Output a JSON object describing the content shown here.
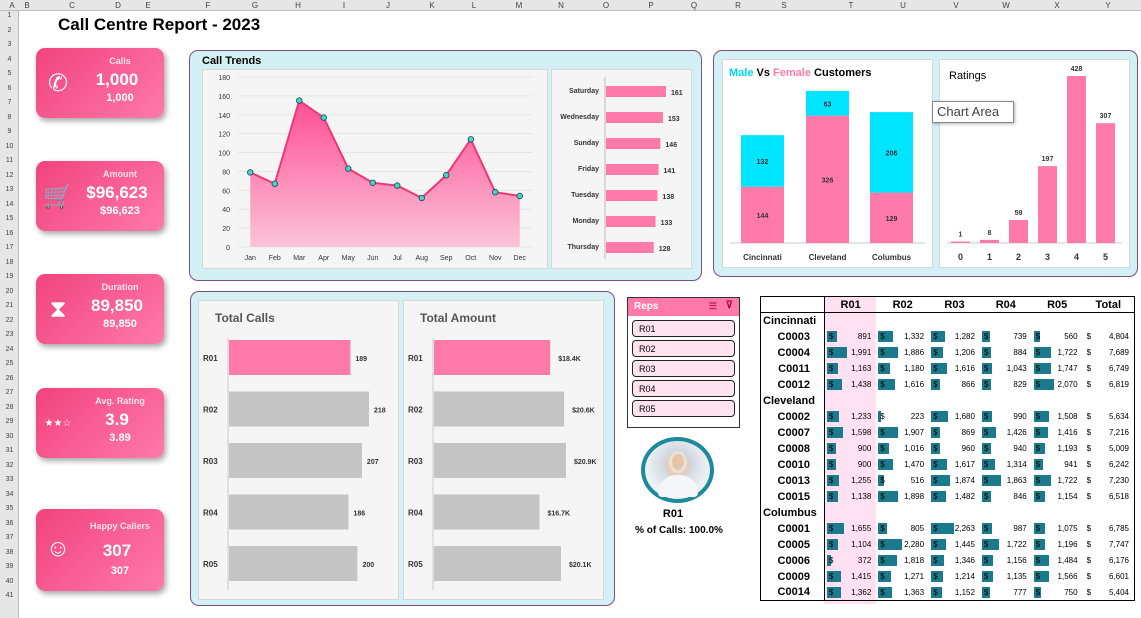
{
  "sheet": {
    "columns": [
      "A",
      "B",
      "C",
      "D",
      "E",
      "F",
      "G",
      "H",
      "I",
      "J",
      "K",
      "L",
      "M",
      "N",
      "O",
      "P",
      "Q",
      "R",
      "S",
      "T",
      "U",
      "V",
      "W",
      "X",
      "Y"
    ],
    "rows": [
      "1",
      "2",
      "3",
      "4",
      "5",
      "6",
      "7",
      "8",
      "9",
      "10",
      "11",
      "12",
      "13",
      "14",
      "15",
      "16",
      "17",
      "18",
      "19",
      "20",
      "21",
      "22",
      "23",
      "24",
      "25",
      "26",
      "27",
      "28",
      "29",
      "30",
      "31",
      "32",
      "33",
      "34",
      "35",
      "36",
      "37",
      "38",
      "39",
      "40",
      "41"
    ]
  },
  "title": "Call Centre Report - 2023",
  "kpis": [
    {
      "label": "Calls",
      "value": "1,000",
      "sub": "1,000",
      "icon": "phone-icon",
      "glyph": "✆"
    },
    {
      "label": "Amount",
      "value": "$96,623",
      "sub": "$96,623",
      "icon": "cart-icon",
      "glyph": "🛒"
    },
    {
      "label": "Duration",
      "value": "89,850",
      "sub": "89,850",
      "icon": "hourglass-icon",
      "glyph": "⧗"
    },
    {
      "label": "Avg. Rating",
      "value": "3.9",
      "sub": "3.89",
      "icon": "stars-icon",
      "glyph": "★★☆"
    },
    {
      "label": "Happy Callers",
      "value": "307",
      "sub": "307",
      "icon": "smiley-icon",
      "glyph": "☺"
    }
  ],
  "call_trends": {
    "title": "Call Trends"
  },
  "gender": {
    "title_male": "Male",
    "title_vs": " Vs ",
    "title_female": "Female",
    "title_rest": " Customers"
  },
  "ratings": {
    "title": "Ratings",
    "tooltip": "Chart Area"
  },
  "total_calls": {
    "title": "Total Calls"
  },
  "total_amount": {
    "title": "Total Amount"
  },
  "slicer": {
    "title": "Reps",
    "items": [
      "R01",
      "R02",
      "R03",
      "R04",
      "R05"
    ]
  },
  "rep": {
    "id": "R01",
    "pct": "% of Calls: 100.0%"
  },
  "colors": {
    "pink": "#ff79ab",
    "cyan": "#00e5ff",
    "grey": "#c4c4c4",
    "teal": "#1b7a8c"
  },
  "chart_data": [
    {
      "type": "area",
      "title": "Call Trends",
      "x": [
        "Jan",
        "Feb",
        "Mar",
        "Apr",
        "May",
        "Jun",
        "Jul",
        "Aug",
        "Sep",
        "Oct",
        "Nov",
        "Dec"
      ],
      "values": [
        79,
        67,
        155,
        137,
        83,
        68,
        65,
        52,
        76,
        114,
        58,
        54
      ],
      "ylim": [
        0,
        180
      ],
      "yticks": [
        0,
        20,
        40,
        60,
        80,
        100,
        120,
        140,
        160,
        180
      ]
    },
    {
      "type": "bar",
      "orientation": "horizontal",
      "categories": [
        "Saturday",
        "Wednesday",
        "Sunday",
        "Friday",
        "Tuesday",
        "Monday",
        "Thursday"
      ],
      "values": [
        161,
        153,
        146,
        141,
        138,
        133,
        128
      ]
    },
    {
      "type": "bar",
      "stacked": true,
      "title": "Male Vs Female Customers",
      "categories": [
        "Cincinnati",
        "Cleveland",
        "Columbus"
      ],
      "series": [
        {
          "name": "Female",
          "values": [
            144,
            326,
            129
          ]
        },
        {
          "name": "Male",
          "values": [
            132,
            63,
            206
          ]
        }
      ]
    },
    {
      "type": "bar",
      "title": "Ratings",
      "categories": [
        "0",
        "1",
        "2",
        "3",
        "4",
        "5"
      ],
      "values": [
        1,
        8,
        59,
        197,
        428,
        307
      ]
    },
    {
      "type": "bar",
      "orientation": "horizontal",
      "title": "Total Calls",
      "categories": [
        "R01",
        "R02",
        "R03",
        "R04",
        "R05"
      ],
      "values": [
        189,
        218,
        207,
        186,
        200
      ],
      "labels": [
        "189",
        "218",
        "207",
        "186",
        "200"
      ]
    },
    {
      "type": "bar",
      "orientation": "horizontal",
      "title": "Total Amount",
      "categories": [
        "R01",
        "R02",
        "R03",
        "R04",
        "R05"
      ],
      "values": [
        18.4,
        20.6,
        20.9,
        16.7,
        20.1
      ],
      "labels": [
        "$18.4K",
        "$20.6K",
        "$20.9K",
        "$16.7K",
        "$20.1K"
      ]
    }
  ],
  "table": {
    "headers": [
      "",
      "R01",
      "R02",
      "R03",
      "R04",
      "R05",
      "Total"
    ],
    "groups": [
      {
        "name": "Cincinnati",
        "rows": [
          {
            "id": "C0003",
            "vals": [
              "891",
              "1,332",
              "1,282",
              "739",
              "560"
            ],
            "fill": [
              0.43,
              0.64,
              0.62,
              0.36,
              0.27
            ],
            "total": "4,804"
          },
          {
            "id": "C0004",
            "vals": [
              "1,991",
              "1,886",
              "1,206",
              "884",
              "1,722"
            ],
            "fill": [
              0.88,
              0.83,
              0.53,
              0.39,
              0.76
            ],
            "total": "7,689"
          },
          {
            "id": "C0011",
            "vals": [
              "1,163",
              "1,180",
              "1,616",
              "1,043",
              "1,747"
            ],
            "fill": [
              0.51,
              0.52,
              0.71,
              0.46,
              0.77
            ],
            "total": "6,749"
          },
          {
            "id": "C0012",
            "vals": [
              "1,438",
              "1,616",
              "866",
              "829",
              "2,070"
            ],
            "fill": [
              0.64,
              0.71,
              0.38,
              0.37,
              0.91
            ],
            "total": "6,819"
          }
        ]
      },
      {
        "name": "Cleveland",
        "rows": [
          {
            "id": "C0002",
            "vals": [
              "1,233",
              "223",
              "1,680",
              "990",
              "1,508"
            ],
            "fill": [
              0.54,
              0.1,
              0.74,
              0.44,
              0.67
            ],
            "total": "5,634"
          },
          {
            "id": "C0007",
            "vals": [
              "1,598",
              "1,907",
              "869",
              "1,426",
              "1,416"
            ],
            "fill": [
              0.71,
              0.84,
              0.38,
              0.63,
              0.63
            ],
            "total": "7,216"
          },
          {
            "id": "C0008",
            "vals": [
              "900",
              "1,016",
              "960",
              "940",
              "1,193"
            ],
            "fill": [
              0.4,
              0.45,
              0.42,
              0.42,
              0.53
            ],
            "total": "5,009"
          },
          {
            "id": "C0010",
            "vals": [
              "900",
              "1,470",
              "1,617",
              "1,314",
              "941"
            ],
            "fill": [
              0.4,
              0.65,
              0.71,
              0.58,
              0.42
            ],
            "total": "6,242"
          },
          {
            "id": "C0013",
            "vals": [
              "1,255",
              "516",
              "1,874",
              "1,863",
              "1,722"
            ],
            "fill": [
              0.55,
              0.23,
              0.83,
              0.82,
              0.76
            ],
            "total": "7,230"
          },
          {
            "id": "C0015",
            "vals": [
              "1,138",
              "1,898",
              "1,482",
              "846",
              "1,154"
            ],
            "fill": [
              0.5,
              0.84,
              0.65,
              0.37,
              0.51
            ],
            "total": "6,518"
          }
        ]
      },
      {
        "name": "Columbus",
        "rows": [
          {
            "id": "C0001",
            "vals": [
              "1,655",
              "805",
              "2,263",
              "987",
              "1,075"
            ],
            "fill": [
              0.73,
              0.36,
              1.0,
              0.44,
              0.48
            ],
            "total": "6,785"
          },
          {
            "id": "C0005",
            "vals": [
              "1,104",
              "2,280",
              "1,445",
              "1,722",
              "1,196"
            ],
            "fill": [
              0.49,
              1.0,
              0.64,
              0.76,
              0.53
            ],
            "total": "7,747"
          },
          {
            "id": "C0006",
            "vals": [
              "372",
              "1,818",
              "1,346",
              "1,156",
              "1,484"
            ],
            "fill": [
              0.16,
              0.8,
              0.59,
              0.51,
              0.66
            ],
            "total": "6,176"
          },
          {
            "id": "C0009",
            "vals": [
              "1,415",
              "1,271",
              "1,214",
              "1,135",
              "1,566"
            ],
            "fill": [
              0.63,
              0.56,
              0.54,
              0.5,
              0.69
            ],
            "total": "6,601"
          },
          {
            "id": "C0014",
            "vals": [
              "1,362",
              "1,363",
              "1,152",
              "777",
              "750"
            ],
            "fill": [
              0.6,
              0.6,
              0.51,
              0.34,
              0.33
            ],
            "total": "5,404"
          }
        ]
      }
    ]
  }
}
